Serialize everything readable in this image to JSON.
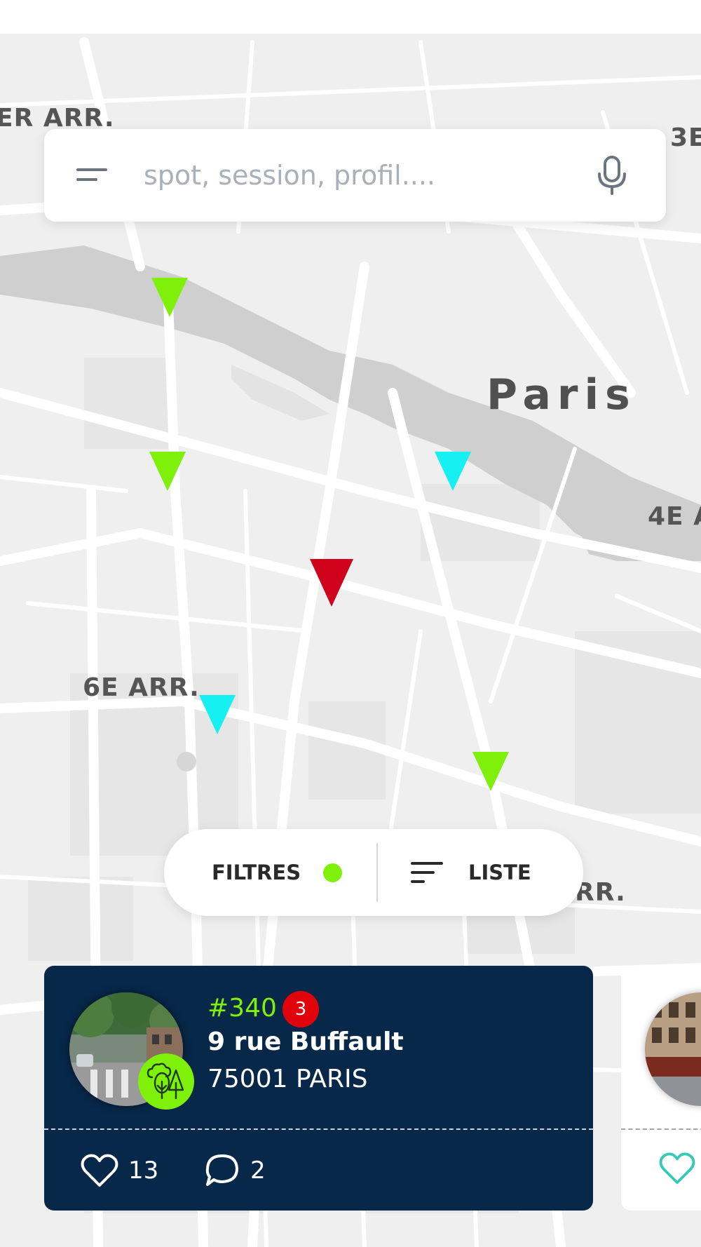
{
  "search": {
    "placeholder": "spot, session, profil...."
  },
  "map": {
    "labels": {
      "arr_top_left": "ER ARR.",
      "arr_top_right": "3E",
      "city": "Paris",
      "arr_right": "4E A",
      "arr_left": "6E ARR.",
      "arr_bottom_right": "RR."
    },
    "marker_colors": {
      "green": "#7ff00a",
      "cyan": "#16f0f2",
      "red": "#d0021b"
    }
  },
  "controls": {
    "filters_label": "FILTRES",
    "list_label": "LISTE"
  },
  "card": {
    "number": "#340",
    "badge_count": "3",
    "street": "9 rue Buffault",
    "city": "75001 PARIS",
    "likes": "13",
    "comments": "2"
  },
  "colors": {
    "accent_green": "#7ff00a",
    "card_navy": "#08284a",
    "badge_red": "#e1030c",
    "heart_teal": "#35c9b6"
  }
}
